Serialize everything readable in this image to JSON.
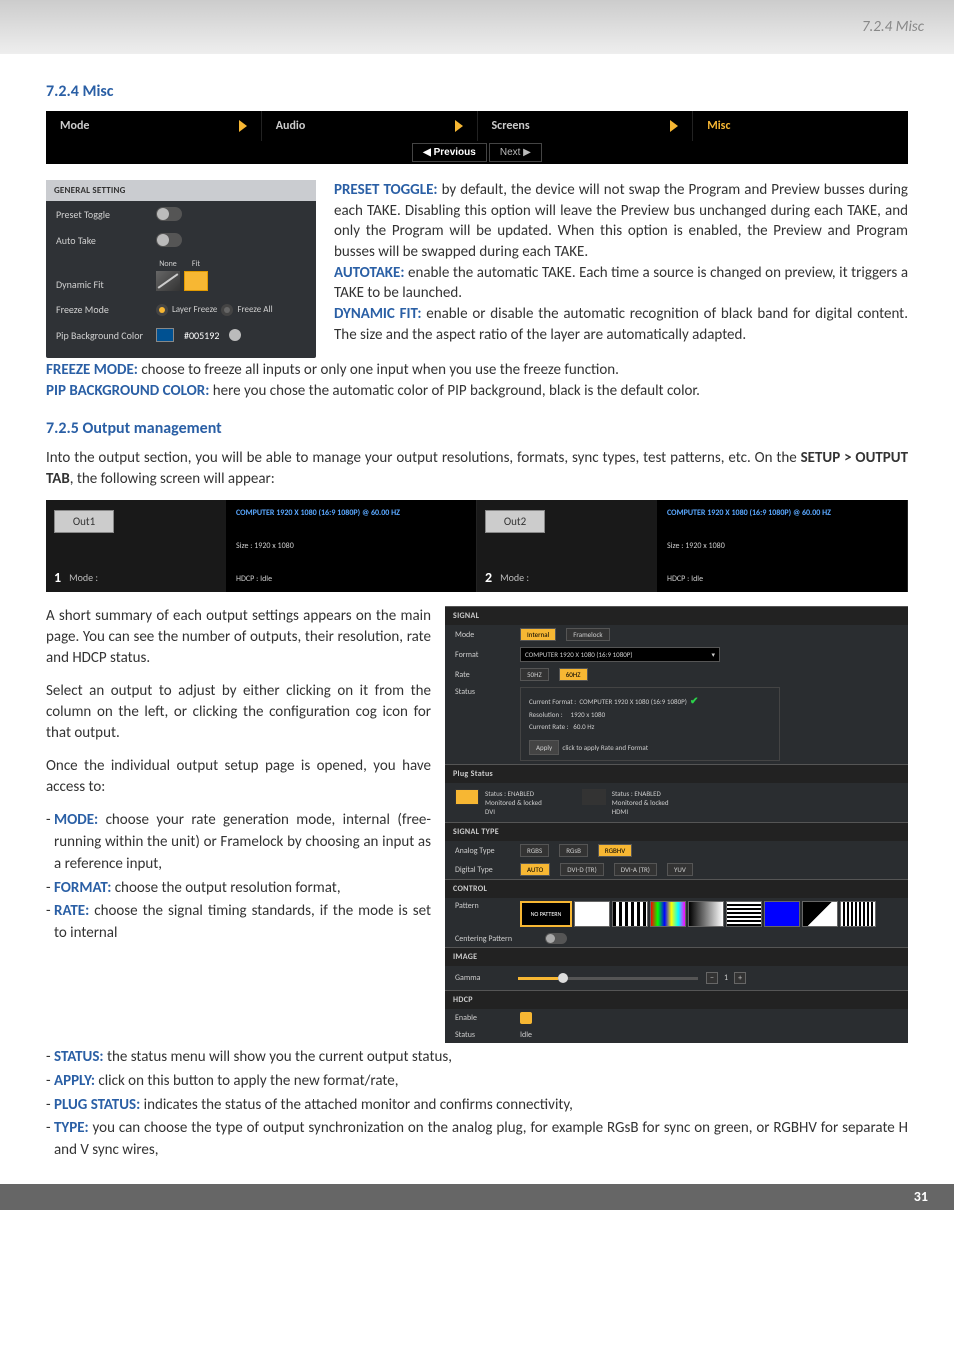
{
  "header": {
    "breadcrumb": "7.2.4 Misc"
  },
  "section1": {
    "title": "7.2.4 Misc"
  },
  "tabs": {
    "items": [
      "Mode",
      "Audio",
      "Screens",
      "Misc"
    ],
    "prev": "◀ Previous",
    "next": "Next ▶"
  },
  "general_setting": {
    "header": "GENERAL SETTING",
    "preset_toggle": "Preset Toggle",
    "auto_take": "Auto Take",
    "dynamic_fit": "Dynamic Fit",
    "dfit_none": "None",
    "dfit_fit": "Fit",
    "freeze_mode": "Freeze Mode",
    "freeze_layer": "Layer Freeze",
    "freeze_all": "Freeze All",
    "pip_bg": "Pip Background Color",
    "pip_hex": "#005192"
  },
  "desc": {
    "preset_toggle_label": "PRESET TOGGLE:",
    "preset_toggle_body": " by default, the device will not swap the Program and Preview busses during each TAKE. Disabling this option will leave the Preview bus unchanged during each TAKE, and only the Program will be updated. When this option is enabled, the Preview and Program busses will be swapped during each TAKE.",
    "autotake_label": "AUTOTAKE:",
    "autotake_body": " enable the automatic TAKE. Each time a source is changed on preview, it triggers a TAKE to be launched.",
    "dfit_label": "DYNAMIC FIT:",
    "dfit_body": " enable or disable the automatic recognition of black band for digital content. The size and the aspect ratio of the layer are automatically adapted.",
    "freeze_label": "FREEZE MODE:",
    "freeze_body": " choose to freeze all inputs or only one input when you use the freeze function.",
    "pip_label": "PIP BACKGROUND COLOR:",
    "pip_body": " here you chose the automatic color of PIP background, black is the default color."
  },
  "section2": {
    "title": "7.2.5 Output management",
    "intro_a": "Into the output section, you will be able to manage your output resolutions, formats, sync types, test patterns, etc. On the ",
    "intro_bold": "SETUP > OUTPUT TAB",
    "intro_b": ", the following screen will appear:"
  },
  "out_strip": {
    "out1": {
      "btn": "Out1",
      "num": "1",
      "mode": "Mode :",
      "format": "COMPUTER 1920 X 1080 (16:9 1080P) @ 60.00 HZ",
      "size": "Size : 1920 x 1080",
      "hdcp": "HDCP : Idle"
    },
    "out2": {
      "btn": "Out2",
      "num": "2",
      "mode": "Mode :",
      "format": "COMPUTER 1920 X 1080 (16:9 1080P) @ 60.00 HZ",
      "size": "Size : 1920 x 1080",
      "hdcp": "HDCP : Idle"
    }
  },
  "leftcol": {
    "p1": "A short summary of each output settings appears on the main page. You can see the number of outputs, their resolution, rate and HDCP status.",
    "p2": "Select an output to adjust by either clicking on it from the column on the left, or clicking the configuration cog icon for that output.",
    "p3": "Once the individual output setup page is opened, you have access to:",
    "mode_label": "MODE:",
    "mode_body": " choose your rate generation mode, internal (free-running within the unit) or Framelock by choosing an input as a reference input,",
    "format_label": "FORMAT:",
    "format_body": " choose the output resolution format,",
    "rate_label": "RATE:",
    "rate_body": " choose the signal timing standards, if the mode is set to internal"
  },
  "detail": {
    "sec_signal": "SIGNAL",
    "mode": "Mode",
    "mode_internal": "Internal",
    "mode_framelock": "Framelock",
    "format": "Format",
    "format_val": "COMPUTER 1920 X 1080 (16:9 1080P)",
    "rate": "Rate",
    "rate_50": "50HZ",
    "rate_60": "60HZ",
    "status": "Status",
    "cur_format": "Current Format :",
    "cur_format_v": "COMPUTER 1920 X 1080 (16:9 1080P)",
    "resolution": "Resolution :",
    "resolution_v": "1920 x 1080",
    "cur_rate": "Current Rate :",
    "cur_rate_v": "60.0 Hz",
    "apply": "Apply",
    "apply_hint": "click to apply Rate and Format",
    "sec_plug": "Plug Status",
    "plug_status": "Status : ENABLED",
    "plug_monitor": "Monitored & locked",
    "plug_dvi": "DVI",
    "plug_hdmi": "HDMI",
    "sec_signal_type": "SIGNAL TYPE",
    "analog_type": "Analog Type",
    "a_rgbs": "RGBS",
    "a_rgsb": "RGsB",
    "a_rgbhv": "RGBHV",
    "digital_type": "Digital Type",
    "d_auto": "AUTO",
    "d_dvid": "DVI-D (TR)",
    "d_dvia": "DVI-A (TR)",
    "d_yuv": "YUV",
    "sec_control": "CONTROL",
    "pattern": "Pattern",
    "nopattern": "NO PATTERN",
    "centering": "Centering Pattern",
    "sec_image": "IMAGE",
    "gamma": "Gamma",
    "gamma_val": "1",
    "sec_hdcp": "HDCP",
    "enable": "Enable",
    "status2": "Status",
    "idle": "Idle"
  },
  "bottom_list": {
    "status_label": "STATUS:",
    "status_body": " the status menu will show you the current output status,",
    "apply_label": "APPLY:",
    "apply_body": " click on this button to apply the new format/rate,",
    "plug_label": "PLUG STATUS:",
    "plug_body": " indicates the status of the attached monitor and confirms connectivity,",
    "type_label": "TYPE:",
    "type_body": " you can choose the type of output synchronization on the analog plug, for example RGsB for sync on green, or RGBHV for separate H and V sync wires,"
  },
  "page_number": "31"
}
